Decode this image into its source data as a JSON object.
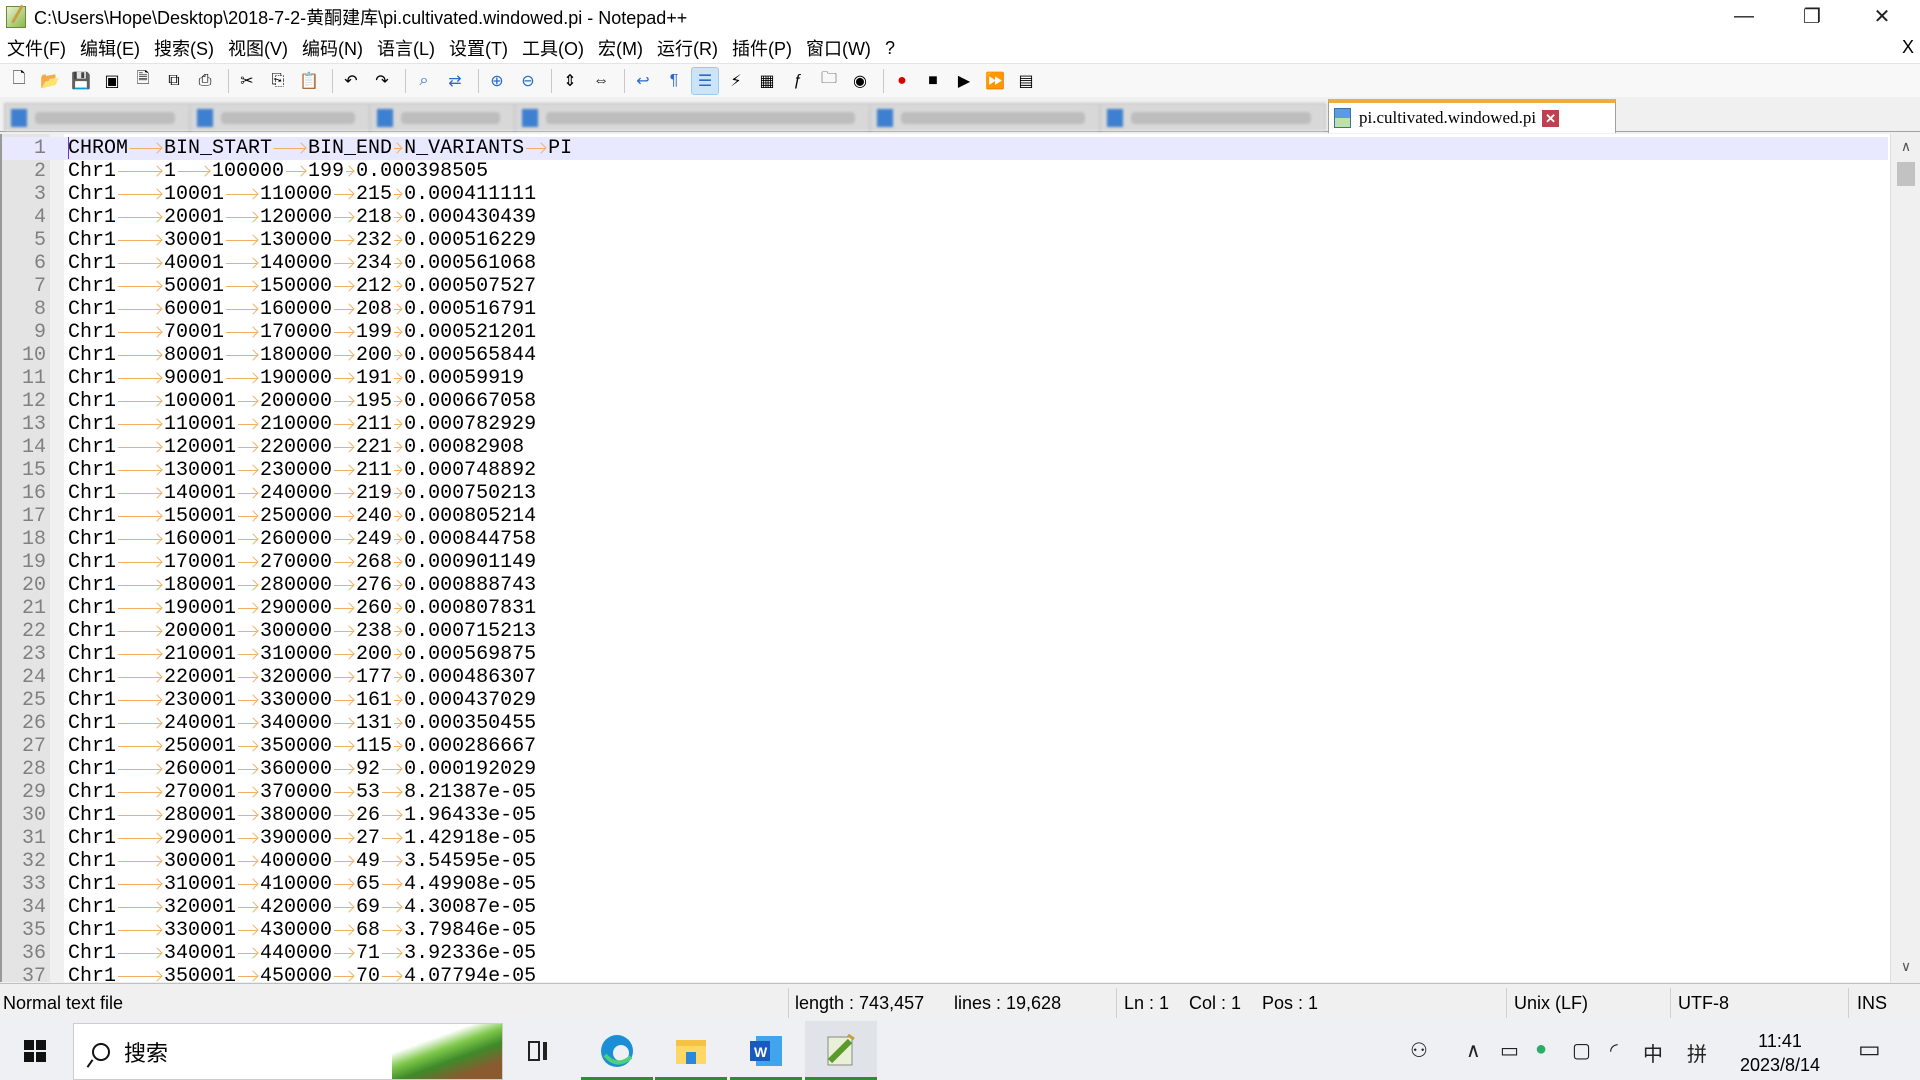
{
  "window": {
    "title": "C:\\Users\\Hope\\Desktop\\2018-7-2-黄酮建库\\pi.cultivated.windowed.pi - Notepad++",
    "minimize": "—",
    "restore": "❐",
    "close": "✕"
  },
  "menu": {
    "items": [
      "文件(F)",
      "编辑(E)",
      "搜索(S)",
      "视图(V)",
      "编码(N)",
      "语言(L)",
      "设置(T)",
      "工具(O)",
      "宏(M)",
      "运行(R)",
      "插件(P)",
      "窗口(W)",
      "?"
    ],
    "close_doc": "X"
  },
  "toolbar": {
    "icons": [
      "new-file",
      "open-file",
      "save",
      "save-all",
      "close",
      "close-all",
      "print",
      "cut",
      "copy",
      "paste",
      "undo",
      "redo",
      "find",
      "replace",
      "zoom-in",
      "zoom-out",
      "sync-vertical",
      "sync-horizontal",
      "word-wrap",
      "show-all-chars",
      "indent-guide",
      "user-language",
      "document-map",
      "function-list",
      "folder-as-workspace",
      "monitoring",
      "record-macro",
      "stop-recording",
      "play-macro",
      "run-macro-multiple",
      "save-macro"
    ]
  },
  "tabs": {
    "active_label": "pi.cultivated.windowed.pi",
    "active_close": "✕",
    "accent": "#f5a93b"
  },
  "editor": {
    "lines": [
      [
        "CHROM",
        "BIN_START",
        "BIN_END",
        "N_VARIANTS",
        "PI"
      ],
      [
        "Chr1",
        "1",
        "100000",
        "199",
        "0.000398505"
      ],
      [
        "Chr1",
        "10001",
        "110000",
        "215",
        "0.000411111"
      ],
      [
        "Chr1",
        "20001",
        "120000",
        "218",
        "0.000430439"
      ],
      [
        "Chr1",
        "30001",
        "130000",
        "232",
        "0.000516229"
      ],
      [
        "Chr1",
        "40001",
        "140000",
        "234",
        "0.000561068"
      ],
      [
        "Chr1",
        "50001",
        "150000",
        "212",
        "0.000507527"
      ],
      [
        "Chr1",
        "60001",
        "160000",
        "208",
        "0.000516791"
      ],
      [
        "Chr1",
        "70001",
        "170000",
        "199",
        "0.000521201"
      ],
      [
        "Chr1",
        "80001",
        "180000",
        "200",
        "0.000565844"
      ],
      [
        "Chr1",
        "90001",
        "190000",
        "191",
        "0.00059919"
      ],
      [
        "Chr1",
        "100001",
        "200000",
        "195",
        "0.000667058"
      ],
      [
        "Chr1",
        "110001",
        "210000",
        "211",
        "0.000782929"
      ],
      [
        "Chr1",
        "120001",
        "220000",
        "221",
        "0.00082908"
      ],
      [
        "Chr1",
        "130001",
        "230000",
        "211",
        "0.000748892"
      ],
      [
        "Chr1",
        "140001",
        "240000",
        "219",
        "0.000750213"
      ],
      [
        "Chr1",
        "150001",
        "250000",
        "240",
        "0.000805214"
      ],
      [
        "Chr1",
        "160001",
        "260000",
        "249",
        "0.000844758"
      ],
      [
        "Chr1",
        "170001",
        "270000",
        "268",
        "0.000901149"
      ],
      [
        "Chr1",
        "180001",
        "280000",
        "276",
        "0.000888743"
      ],
      [
        "Chr1",
        "190001",
        "290000",
        "260",
        "0.000807831"
      ],
      [
        "Chr1",
        "200001",
        "300000",
        "238",
        "0.000715213"
      ],
      [
        "Chr1",
        "210001",
        "310000",
        "200",
        "0.000569875"
      ],
      [
        "Chr1",
        "220001",
        "320000",
        "177",
        "0.000486307"
      ],
      [
        "Chr1",
        "230001",
        "330000",
        "161",
        "0.000437029"
      ],
      [
        "Chr1",
        "240001",
        "340000",
        "131",
        "0.000350455"
      ],
      [
        "Chr1",
        "250001",
        "350000",
        "115",
        "0.000286667"
      ],
      [
        "Chr1",
        "260001",
        "360000",
        "92",
        "0.000192029"
      ],
      [
        "Chr1",
        "270001",
        "370000",
        "53",
        "8.21387e-05"
      ],
      [
        "Chr1",
        "280001",
        "380000",
        "26",
        "1.96433e-05"
      ],
      [
        "Chr1",
        "290001",
        "390000",
        "27",
        "1.42918e-05"
      ],
      [
        "Chr1",
        "300001",
        "400000",
        "49",
        "3.54595e-05"
      ],
      [
        "Chr1",
        "310001",
        "410000",
        "65",
        "4.49908e-05"
      ],
      [
        "Chr1",
        "320001",
        "420000",
        "69",
        "4.30087e-05"
      ],
      [
        "Chr1",
        "330001",
        "430000",
        "68",
        "3.79846e-05"
      ],
      [
        "Chr1",
        "340001",
        "440000",
        "71",
        "3.92336e-05"
      ],
      [
        "Chr1",
        "350001",
        "450000",
        "70",
        "4.07794e-05"
      ]
    ]
  },
  "statusbar": {
    "file_type": "Normal text file",
    "length": "length : 743,457",
    "lines": "lines : 19,628",
    "ln": "Ln : 1",
    "col": "Col : 1",
    "pos": "Pos : 1",
    "eol": "Unix (LF)",
    "encoding": "UTF-8",
    "mode": "INS"
  },
  "taskbar": {
    "search_label": "搜索",
    "ime_lang": "中",
    "ime_mode": "拼",
    "time": "11:41",
    "date": "2023/8/14"
  }
}
